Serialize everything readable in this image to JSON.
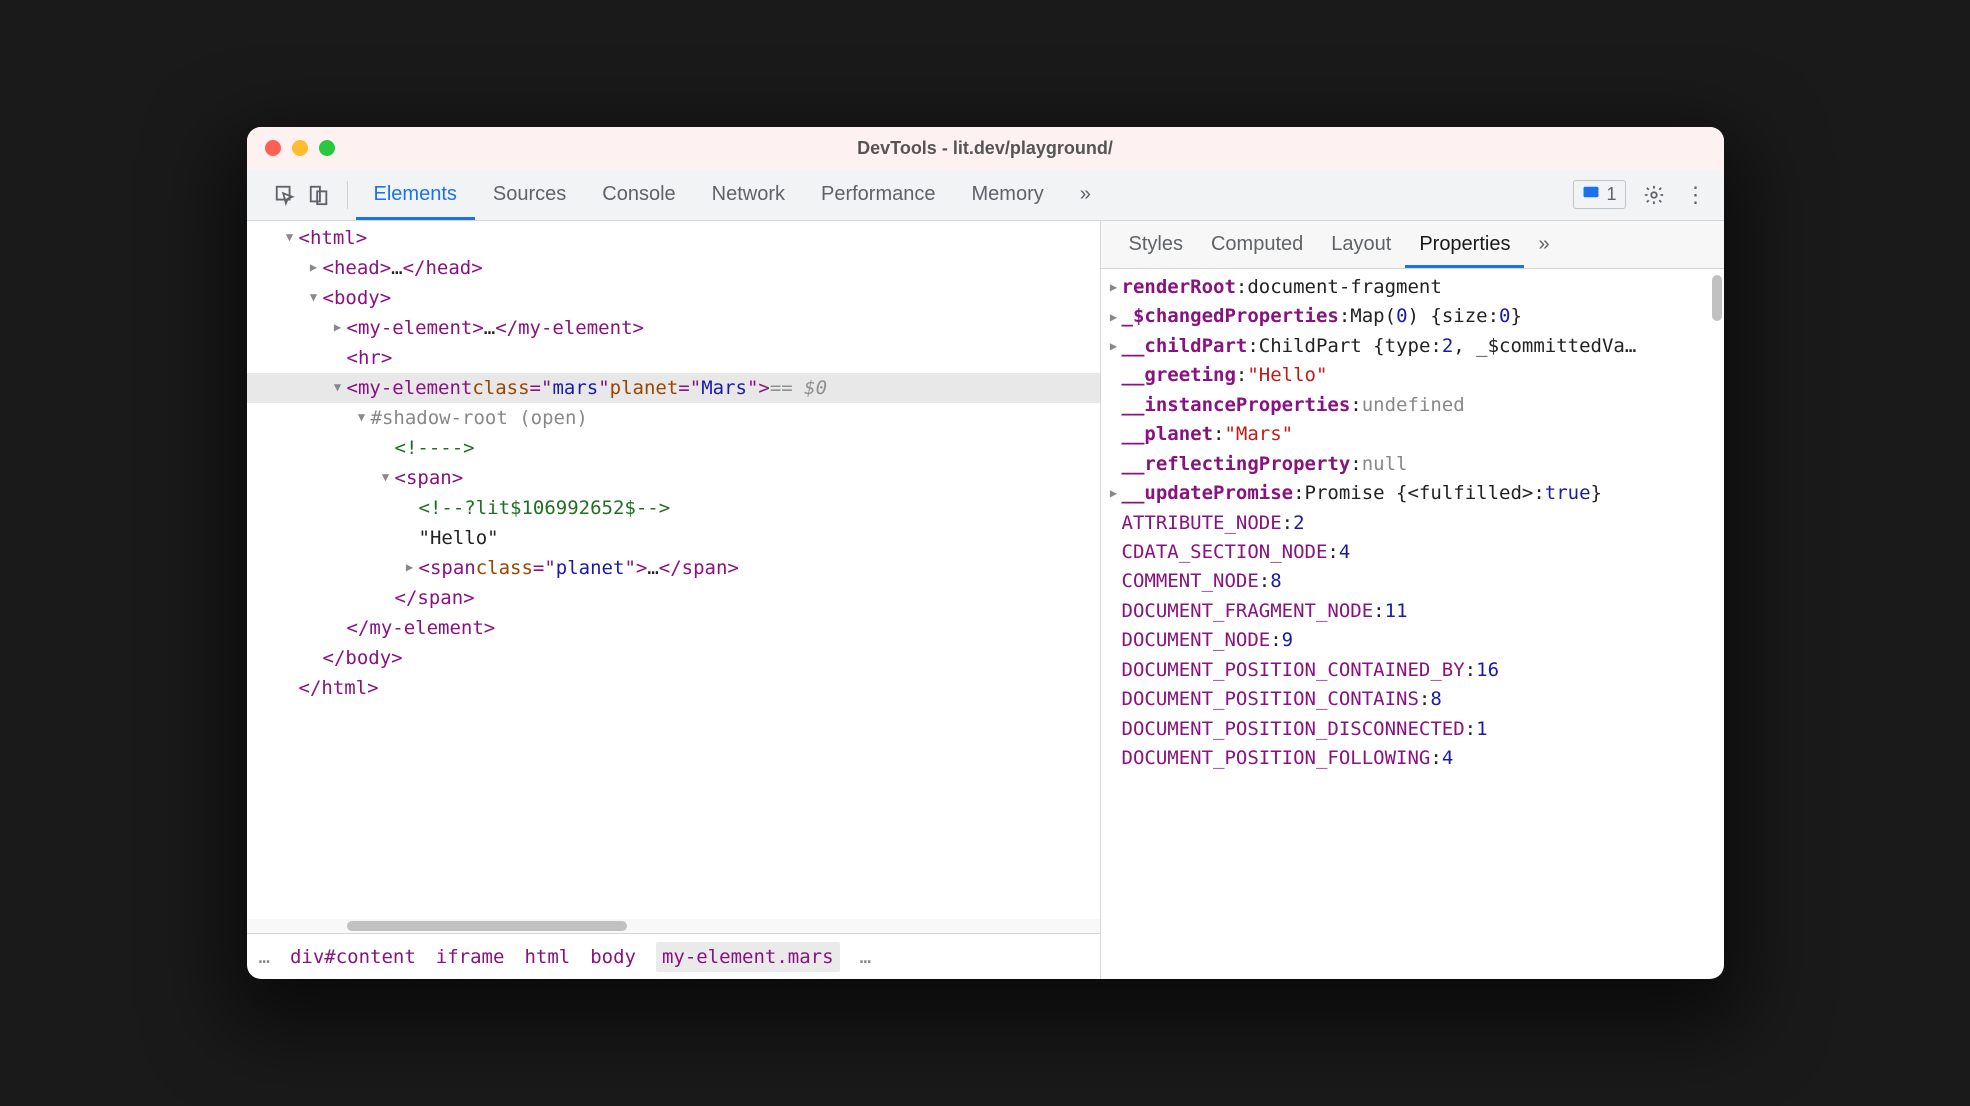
{
  "window": {
    "title": "DevTools - lit.dev/playground/"
  },
  "mainTabs": [
    "Elements",
    "Sources",
    "Console",
    "Network",
    "Performance",
    "Memory"
  ],
  "activeMainTab": "Elements",
  "issueCount": "1",
  "subTabs": [
    "Styles",
    "Computed",
    "Layout",
    "Properties"
  ],
  "activeSubTab": "Properties",
  "domRows": [
    {
      "indent": 1,
      "arrow": "down",
      "parts": [
        {
          "t": "tag",
          "s": "<html>"
        }
      ]
    },
    {
      "indent": 2,
      "arrow": "right",
      "parts": [
        {
          "t": "tag",
          "s": "<head>"
        },
        {
          "t": "text",
          "s": "…"
        },
        {
          "t": "tag",
          "s": "</head>"
        }
      ]
    },
    {
      "indent": 2,
      "arrow": "down",
      "parts": [
        {
          "t": "tag",
          "s": "<body>"
        }
      ]
    },
    {
      "indent": 3,
      "arrow": "right",
      "parts": [
        {
          "t": "tag",
          "s": "<my-element>"
        },
        {
          "t": "text",
          "s": "…"
        },
        {
          "t": "tag",
          "s": "</my-element>"
        }
      ]
    },
    {
      "indent": 3,
      "arrow": "",
      "parts": [
        {
          "t": "tag",
          "s": "<hr>"
        }
      ]
    },
    {
      "indent": 3,
      "arrow": "down",
      "selected": true,
      "parts": [
        {
          "t": "tag",
          "s": "<my-element "
        },
        {
          "t": "attr",
          "s": "class"
        },
        {
          "t": "tag",
          "s": "=\""
        },
        {
          "t": "val",
          "s": "mars"
        },
        {
          "t": "tag",
          "s": "\" "
        },
        {
          "t": "attr",
          "s": "planet"
        },
        {
          "t": "tag",
          "s": "=\""
        },
        {
          "t": "val",
          "s": "Mars"
        },
        {
          "t": "tag",
          "s": "\">"
        },
        {
          "t": "dollar",
          "s": " == $0"
        }
      ]
    },
    {
      "indent": 4,
      "arrow": "down",
      "parts": [
        {
          "t": "shadow",
          "s": "#shadow-root (open)"
        }
      ]
    },
    {
      "indent": 5,
      "arrow": "",
      "parts": [
        {
          "t": "comment",
          "s": "<!---->"
        }
      ]
    },
    {
      "indent": 5,
      "arrow": "down",
      "parts": [
        {
          "t": "tag",
          "s": "<span>"
        }
      ]
    },
    {
      "indent": 6,
      "arrow": "",
      "parts": [
        {
          "t": "comment",
          "s": "<!--?lit$106992652$-->"
        }
      ]
    },
    {
      "indent": 6,
      "arrow": "",
      "parts": [
        {
          "t": "text",
          "s": "\"Hello\""
        }
      ]
    },
    {
      "indent": 6,
      "arrow": "right",
      "parts": [
        {
          "t": "tag",
          "s": "<span "
        },
        {
          "t": "attr",
          "s": "class"
        },
        {
          "t": "tag",
          "s": "=\""
        },
        {
          "t": "val",
          "s": "planet"
        },
        {
          "t": "tag",
          "s": "\">"
        },
        {
          "t": "text",
          "s": "…"
        },
        {
          "t": "tag",
          "s": "</span>"
        }
      ]
    },
    {
      "indent": 5,
      "arrow": "",
      "parts": [
        {
          "t": "tag",
          "s": "</span>"
        }
      ]
    },
    {
      "indent": 3,
      "arrow": "",
      "parts": [
        {
          "t": "tag",
          "s": "</my-element>"
        }
      ]
    },
    {
      "indent": 2,
      "arrow": "",
      "parts": [
        {
          "t": "tag",
          "s": "</body>"
        }
      ]
    },
    {
      "indent": 1,
      "arrow": "",
      "parts": [
        {
          "t": "tag",
          "s": "</html>"
        }
      ]
    }
  ],
  "breadcrumb": {
    "leftDots": "…",
    "items": [
      "div#content",
      "iframe",
      "html",
      "body",
      "my-element.mars"
    ],
    "selectedIndex": 4,
    "rightDots": "…"
  },
  "properties": [
    {
      "tw": "right",
      "bold": true,
      "key": "renderRoot",
      "valParts": [
        {
          "t": "obj",
          "s": "document-fragment"
        }
      ]
    },
    {
      "tw": "right",
      "bold": true,
      "key": "_$changedProperties",
      "valParts": [
        {
          "t": "obj",
          "s": "Map("
        },
        {
          "t": "num",
          "s": "0"
        },
        {
          "t": "obj",
          "s": ") {size: "
        },
        {
          "t": "num",
          "s": "0"
        },
        {
          "t": "obj",
          "s": "}"
        }
      ]
    },
    {
      "tw": "right",
      "bold": true,
      "key": "__childPart",
      "valParts": [
        {
          "t": "obj",
          "s": "ChildPart {type: "
        },
        {
          "t": "num",
          "s": "2"
        },
        {
          "t": "obj",
          "s": ", _$committedVa…"
        }
      ]
    },
    {
      "tw": "",
      "bold": true,
      "key": "__greeting",
      "valParts": [
        {
          "t": "str",
          "s": "\"Hello\""
        }
      ]
    },
    {
      "tw": "",
      "bold": true,
      "key": "__instanceProperties",
      "valParts": [
        {
          "t": "undef",
          "s": "undefined"
        }
      ]
    },
    {
      "tw": "",
      "bold": true,
      "key": "__planet",
      "valParts": [
        {
          "t": "str",
          "s": "\"Mars\""
        }
      ]
    },
    {
      "tw": "",
      "bold": true,
      "key": "__reflectingProperty",
      "valParts": [
        {
          "t": "undef",
          "s": "null"
        }
      ]
    },
    {
      "tw": "right",
      "bold": true,
      "key": "__updatePromise",
      "valParts": [
        {
          "t": "obj",
          "s": "Promise {<fulfilled>: "
        },
        {
          "t": "num",
          "s": "true"
        },
        {
          "t": "obj",
          "s": "}"
        }
      ]
    },
    {
      "tw": "",
      "bold": false,
      "key": "ATTRIBUTE_NODE",
      "valParts": [
        {
          "t": "num",
          "s": "2"
        }
      ]
    },
    {
      "tw": "",
      "bold": false,
      "key": "CDATA_SECTION_NODE",
      "valParts": [
        {
          "t": "num",
          "s": "4"
        }
      ]
    },
    {
      "tw": "",
      "bold": false,
      "key": "COMMENT_NODE",
      "valParts": [
        {
          "t": "num",
          "s": "8"
        }
      ]
    },
    {
      "tw": "",
      "bold": false,
      "key": "DOCUMENT_FRAGMENT_NODE",
      "valParts": [
        {
          "t": "num",
          "s": "11"
        }
      ]
    },
    {
      "tw": "",
      "bold": false,
      "key": "DOCUMENT_NODE",
      "valParts": [
        {
          "t": "num",
          "s": "9"
        }
      ]
    },
    {
      "tw": "",
      "bold": false,
      "key": "DOCUMENT_POSITION_CONTAINED_BY",
      "valParts": [
        {
          "t": "num",
          "s": "16"
        }
      ]
    },
    {
      "tw": "",
      "bold": false,
      "key": "DOCUMENT_POSITION_CONTAINS",
      "valParts": [
        {
          "t": "num",
          "s": "8"
        }
      ]
    },
    {
      "tw": "",
      "bold": false,
      "key": "DOCUMENT_POSITION_DISCONNECTED",
      "valParts": [
        {
          "t": "num",
          "s": "1"
        }
      ]
    },
    {
      "tw": "",
      "bold": false,
      "key": "DOCUMENT_POSITION_FOLLOWING",
      "valParts": [
        {
          "t": "num",
          "s": "4"
        }
      ]
    }
  ]
}
